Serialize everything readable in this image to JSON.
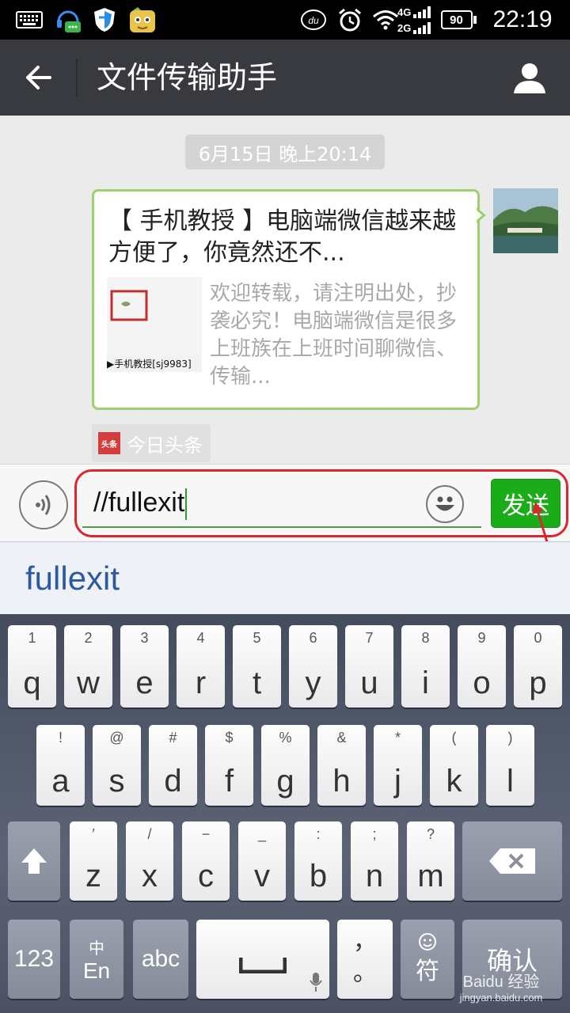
{
  "status_bar": {
    "time": "22:19",
    "battery": "90",
    "network_top": "4G",
    "network_bottom": "2G",
    "notif_icons": [
      "keyboard-icon",
      "chat-bot-icon",
      "shield-icon",
      "game-icon"
    ],
    "status_icons": [
      "baidu-du-icon",
      "alarm-icon",
      "wifi-icon",
      "signal-icon",
      "battery-icon"
    ]
  },
  "header": {
    "title": "文件传输助手",
    "back_icon": "arrow-left-icon",
    "profile_icon": "person-icon"
  },
  "chat": {
    "timestamp": "6月15日 晚上20:14",
    "message": {
      "title": "【 手机教授 】电脑端微信越来越方便了，你竟然还不...",
      "description": "欢迎转载，请注明出处，抄袭必究！电脑端微信是很多上班族在上班时间聊微信、传输...",
      "thumb_caption": "▶手机教授[sj9983]"
    },
    "source": {
      "icon_text": "头条",
      "label": "今日头条"
    }
  },
  "input": {
    "value": "//fullexit",
    "send_label": "发送"
  },
  "suggestion": {
    "word": "fullexit"
  },
  "keyboard": {
    "row1": [
      {
        "main": "q",
        "sub": "1"
      },
      {
        "main": "w",
        "sub": "2"
      },
      {
        "main": "e",
        "sub": "3"
      },
      {
        "main": "r",
        "sub": "4"
      },
      {
        "main": "t",
        "sub": "5"
      },
      {
        "main": "y",
        "sub": "6"
      },
      {
        "main": "u",
        "sub": "7"
      },
      {
        "main": "i",
        "sub": "8"
      },
      {
        "main": "o",
        "sub": "9"
      },
      {
        "main": "p",
        "sub": "0"
      }
    ],
    "row2": [
      {
        "main": "a",
        "sub": "!"
      },
      {
        "main": "s",
        "sub": "@"
      },
      {
        "main": "d",
        "sub": "#"
      },
      {
        "main": "f",
        "sub": "$"
      },
      {
        "main": "g",
        "sub": "%"
      },
      {
        "main": "h",
        "sub": "&"
      },
      {
        "main": "j",
        "sub": "*"
      },
      {
        "main": "k",
        "sub": "("
      },
      {
        "main": "l",
        "sub": ")"
      }
    ],
    "row3": [
      {
        "main": "z",
        "sub": "′"
      },
      {
        "main": "x",
        "sub": "/"
      },
      {
        "main": "c",
        "sub": "−"
      },
      {
        "main": "v",
        "sub": "_"
      },
      {
        "main": "b",
        "sub": ":"
      },
      {
        "main": "n",
        "sub": ";"
      },
      {
        "main": "m",
        "sub": "?"
      }
    ],
    "num_label": "123",
    "lang_top": "中",
    "lang_bottom": "En",
    "abc_label": "abc",
    "comma_top": "，",
    "comma_bottom": "。",
    "symbol_label": "符",
    "confirm_label": "确认"
  },
  "watermark": {
    "line1": "Baidu 经验",
    "line2": "jingyan.baidu.com"
  },
  "colors": {
    "send_green": "#1aad19",
    "header_dark": "#393a3f",
    "highlight_red": "#d9272d",
    "bubble_border": "#9ed06f"
  }
}
